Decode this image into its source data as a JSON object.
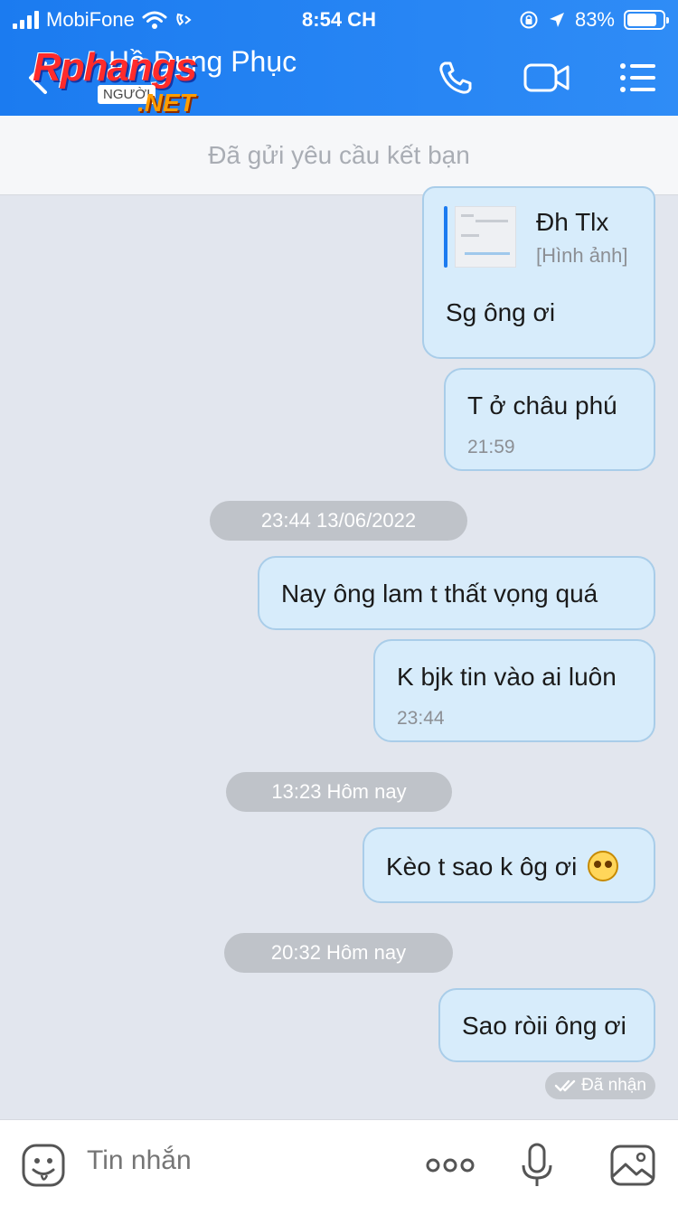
{
  "status_bar": {
    "carrier": "MobiFone",
    "time": "8:54 CH",
    "battery": "83%",
    "battery_level": 0.83
  },
  "header": {
    "contact_name": "Hồ Dung Phục",
    "watermark": {
      "brand": "Rphangs",
      "sub": "NGƯỜI",
      "suffix": ".NET"
    }
  },
  "friend_request_banner": "Đã gửi yêu cầu kết bạn",
  "messages": [
    {
      "quote": {
        "name": "Đh  Tlx",
        "type": "[Hình ảnh]"
      },
      "text": "Sg ông ơi"
    },
    {
      "text": "T ở châu phú",
      "time": "21:59"
    },
    {
      "date_divider": "23:44 13/06/2022"
    },
    {
      "text": "Nay ông lam t thất vọng quá"
    },
    {
      "text": "K bjk tin vào ai luôn",
      "time": "23:44"
    },
    {
      "date_divider": "13:23 Hôm nay"
    },
    {
      "text": "Kèo t sao k ôg ơi",
      "emoji": "pleading-face-emoji"
    },
    {
      "date_divider": "20:32 Hôm nay"
    },
    {
      "text": "Sao ròii ông ơi"
    }
  ],
  "receipt": "Đã nhận",
  "input": {
    "placeholder": "Tin nhắn"
  },
  "icons": [
    "back-icon",
    "phone-icon",
    "video-call-icon",
    "menu-icon",
    "sticker-icon",
    "more-icon",
    "microphone-icon",
    "image-icon"
  ],
  "colors": {
    "header": "#1b7bf0",
    "bubble": "#d7ecfb",
    "background": "#e2e6ee"
  }
}
